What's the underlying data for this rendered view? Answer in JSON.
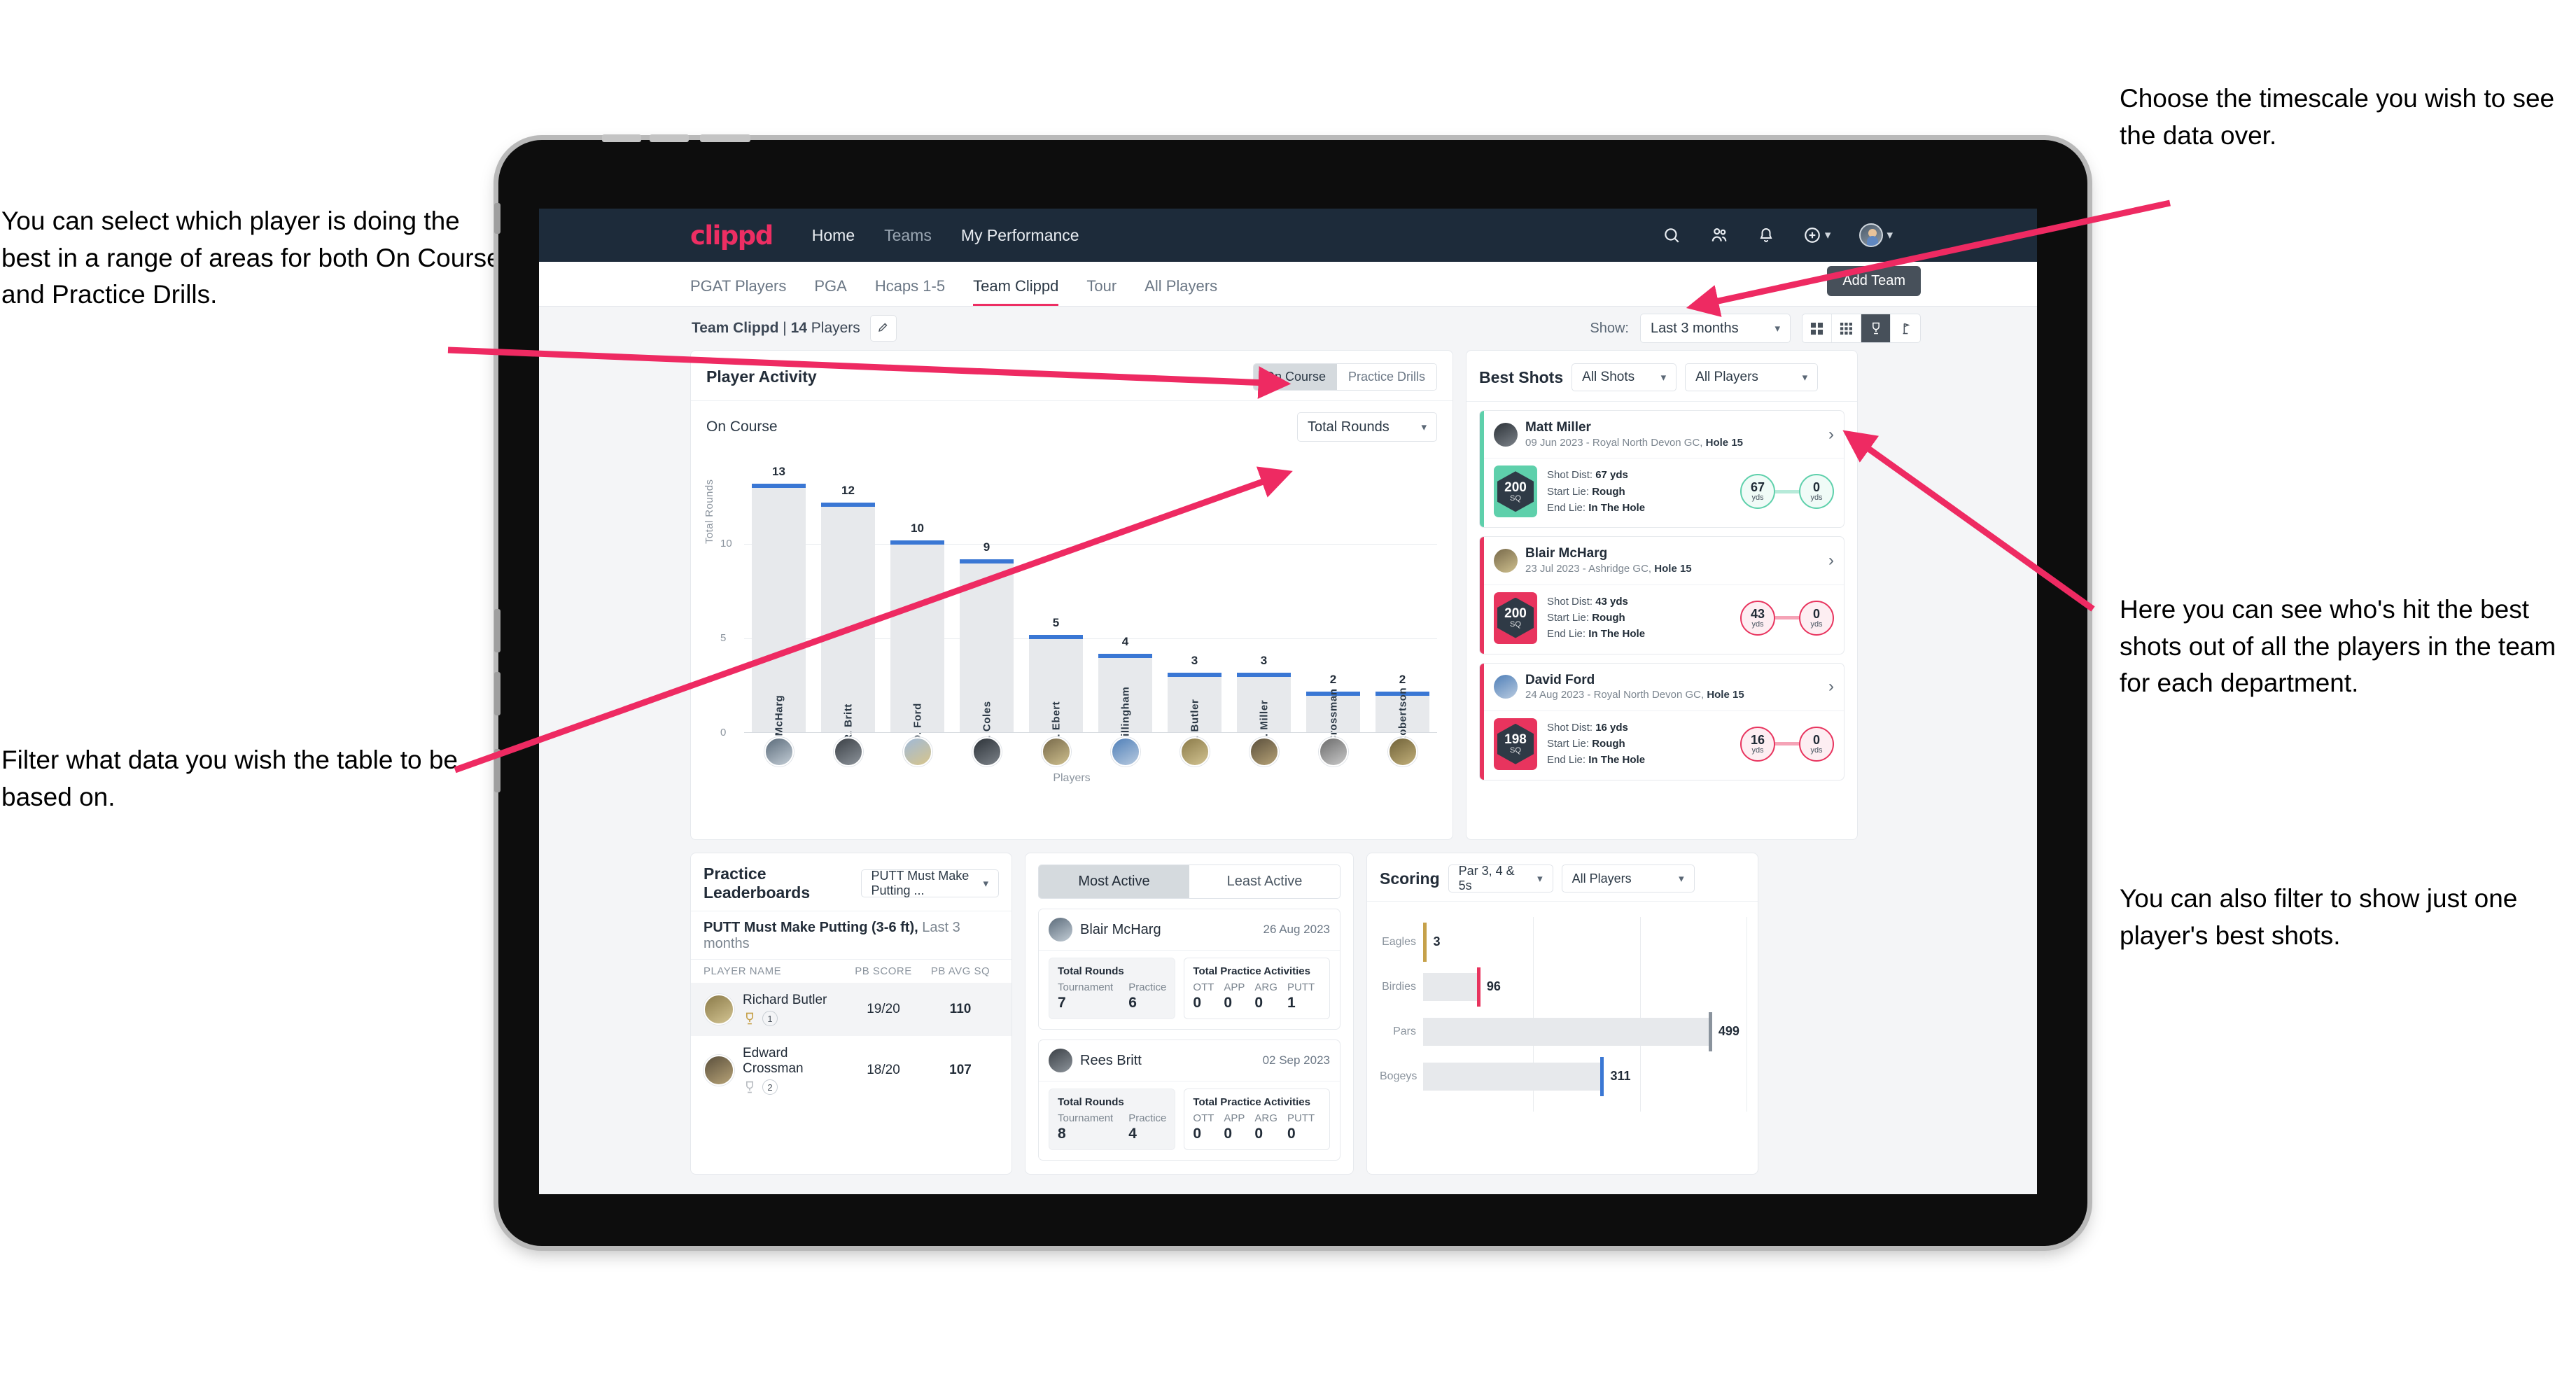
{
  "annotations": {
    "left_top": "You can select which player is doing the best in a range of areas for both On Course and Practice Drills.",
    "left_bottom": "Filter what data you wish the table to be based on.",
    "right_top": "Choose the timescale you wish to see the data over.",
    "right_mid": "Here you can see who's hit the best shots out of all the players in the team for each department.",
    "right_bottom": "You can also filter to show just one player's best shots."
  },
  "topnav": {
    "logo": "clippd",
    "links": [
      {
        "label": "Home",
        "active": true
      },
      {
        "label": "Teams",
        "active": false
      },
      {
        "label": "My Performance",
        "active": true
      }
    ],
    "icons": [
      "search-icon",
      "people-icon",
      "bell-icon",
      "plus-circle-icon",
      "avatar"
    ]
  },
  "tabbar": {
    "tabs": [
      {
        "label": "PGAT Players",
        "active": false
      },
      {
        "label": "PGA",
        "active": false
      },
      {
        "label": "Hcaps 1-5",
        "active": false
      },
      {
        "label": "Team Clippd",
        "active": true
      },
      {
        "label": "Tour",
        "active": false
      },
      {
        "label": "All Players",
        "active": false
      }
    ],
    "add_team_label": "Add Team"
  },
  "toolbar": {
    "team_name": "Team Clippd",
    "separator": " | ",
    "player_count": "14",
    "players_word": " Players",
    "edit_icon": "pencil-icon",
    "show_label": "Show:",
    "timescale_value": "Last 3 months",
    "view_icons": [
      "grid-large-icon",
      "grid-small-icon",
      "trophy-icon",
      "flagstick-icon"
    ],
    "view_selected_index": 2
  },
  "player_activity": {
    "title": "Player Activity",
    "segments": [
      {
        "label": "On Course",
        "active": true
      },
      {
        "label": "Practice Drills",
        "active": false
      }
    ],
    "sub_label": "On Course",
    "metric_select": "Total Rounds"
  },
  "chart_data": {
    "type": "bar",
    "title": "Player Activity - On Course",
    "xlabel": "Players",
    "ylabel": "Total Rounds",
    "ylim": [
      0,
      14
    ],
    "yticks": [
      0,
      5,
      10
    ],
    "grid": true,
    "categories": [
      "B. McHarg",
      "R. Britt",
      "D. Ford",
      "J. Coles",
      "E. Ebert",
      "D. Billingham",
      "R. Butler",
      "M. Miller",
      "E. Crossman",
      "C. Robertson"
    ],
    "values": [
      13,
      12,
      10,
      9,
      5,
      4,
      3,
      3,
      2,
      2
    ],
    "bar_color": "#e7e9ec",
    "cap_color": "#3a77d4"
  },
  "best_shots": {
    "title": "Best Shots",
    "shot_filter": "All Shots",
    "player_filter": "All Players",
    "cards": [
      {
        "name": "Matt Miller",
        "meta_prefix": "09 Jun 2023 - Royal North Devon GC, ",
        "meta_hole": "Hole 15",
        "sq": "200",
        "sq_unit": "SQ",
        "accent": "#5ed0ab",
        "shot_dist_label": "Shot Dist: ",
        "shot_dist_value": "67 yds",
        "start_lie_label": "Start Lie: ",
        "start_lie_value": "Rough",
        "end_lie_label": "End Lie: ",
        "end_lie_value": "In The Hole",
        "from_value": "67",
        "from_unit": "yds",
        "to_value": "0",
        "to_unit": "yds"
      },
      {
        "name": "Blair McHarg",
        "meta_prefix": "23 Jul 2023 - Ashridge GC, ",
        "meta_hole": "Hole 15",
        "sq": "200",
        "sq_unit": "SQ",
        "accent": "#e8345e",
        "shot_dist_label": "Shot Dist: ",
        "shot_dist_value": "43 yds",
        "start_lie_label": "Start Lie: ",
        "start_lie_value": "Rough",
        "end_lie_label": "End Lie: ",
        "end_lie_value": "In The Hole",
        "from_value": "43",
        "from_unit": "yds",
        "to_value": "0",
        "to_unit": "yds"
      },
      {
        "name": "David Ford",
        "meta_prefix": "24 Aug 2023 - Royal North Devon GC, ",
        "meta_hole": "Hole 15",
        "sq": "198",
        "sq_unit": "SQ",
        "accent": "#e8345e",
        "shot_dist_label": "Shot Dist: ",
        "shot_dist_value": "16 yds",
        "start_lie_label": "Start Lie: ",
        "start_lie_value": "Rough",
        "end_lie_label": "End Lie: ",
        "end_lie_value": "In The Hole",
        "from_value": "16",
        "from_unit": "yds",
        "to_value": "0",
        "to_unit": "yds"
      }
    ]
  },
  "practice_leaderboards": {
    "title": "Practice Leaderboards",
    "drill_select": "PUTT Must Make Putting ...",
    "subtitle_bold": "PUTT Must Make Putting (3-6 ft),",
    "subtitle_rest": " Last 3 months",
    "columns": [
      "PLAYER NAME",
      "PB SCORE",
      "PB AVG SQ"
    ],
    "rows": [
      {
        "name": "Richard Butler",
        "rank": "1",
        "trophy": "gold",
        "pb_score": "19/20",
        "pb_avg_sq": "110"
      },
      {
        "name": "Edward Crossman",
        "rank": "2",
        "trophy": "silver",
        "pb_score": "18/20",
        "pb_avg_sq": "107"
      }
    ]
  },
  "activity_panel": {
    "tabs": [
      {
        "label": "Most Active",
        "active": true
      },
      {
        "label": "Least Active",
        "active": false
      }
    ],
    "cards": [
      {
        "name": "Blair McHarg",
        "date": "26 Aug 2023",
        "rounds_title": "Total Rounds",
        "rounds_keys": [
          "Tournament",
          "Practice"
        ],
        "rounds_values": [
          "7",
          "6"
        ],
        "practice_title": "Total Practice Activities",
        "practice_keys": [
          "OTT",
          "APP",
          "ARG",
          "PUTT"
        ],
        "practice_values": [
          "0",
          "0",
          "0",
          "1"
        ]
      },
      {
        "name": "Rees Britt",
        "date": "02 Sep 2023",
        "rounds_title": "Total Rounds",
        "rounds_keys": [
          "Tournament",
          "Practice"
        ],
        "rounds_values": [
          "8",
          "4"
        ],
        "practice_title": "Total Practice Activities",
        "practice_keys": [
          "OTT",
          "APP",
          "ARG",
          "PUTT"
        ],
        "practice_values": [
          "0",
          "0",
          "0",
          "0"
        ]
      }
    ]
  },
  "scoring": {
    "title": "Scoring",
    "par_filter": "Par 3, 4 & 5s",
    "player_filter": "All Players",
    "chart": {
      "type": "bar",
      "orientation": "horizontal",
      "categories": [
        "Eagles",
        "Birdies",
        "Pars",
        "Bogeys"
      ],
      "values": [
        3,
        96,
        499,
        311
      ],
      "max": 560,
      "cap_colors": [
        "#c6a14a",
        "#e8345e",
        "#8a939d",
        "#3a77d4"
      ]
    }
  }
}
